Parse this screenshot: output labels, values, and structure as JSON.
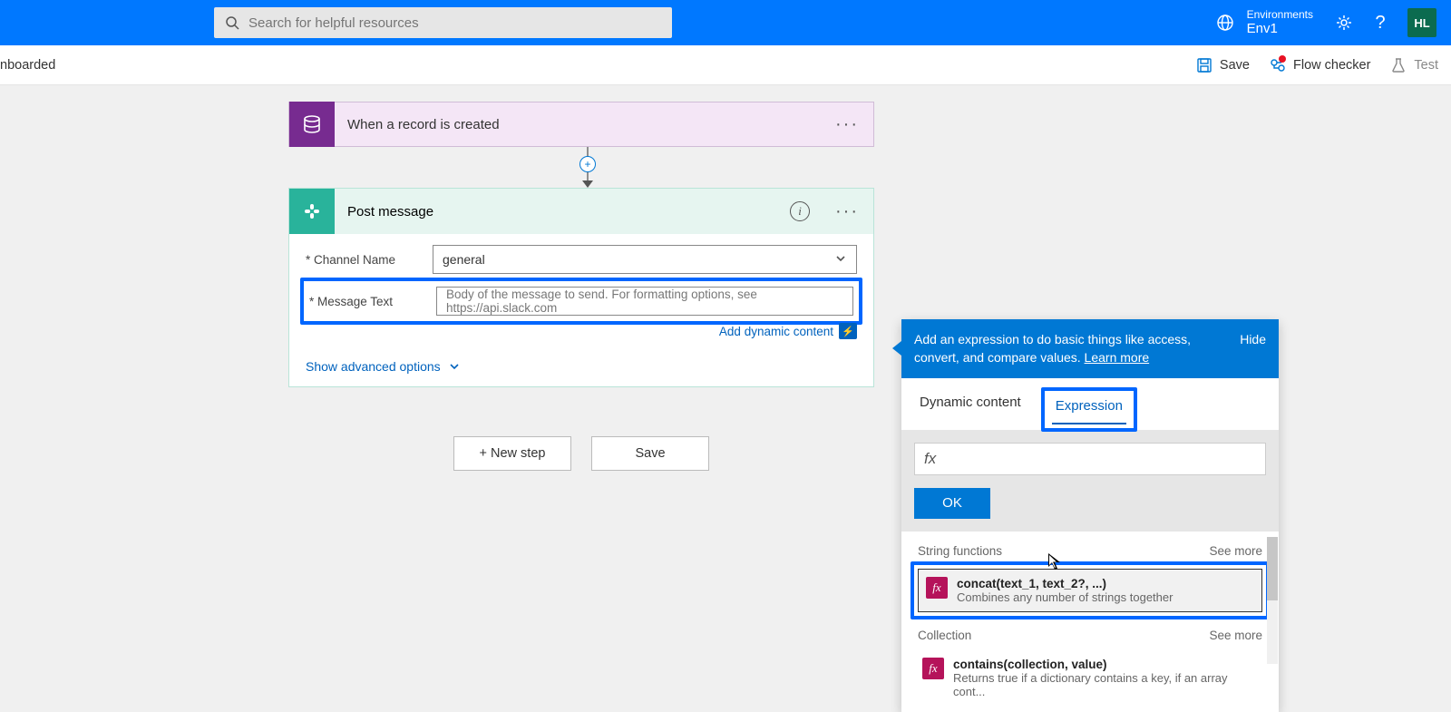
{
  "header": {
    "search_placeholder": "Search for helpful resources",
    "env_label": "Environments",
    "env_name": "Env1",
    "avatar": "HL"
  },
  "cmdbar": {
    "left_text": "nboarded",
    "save": "Save",
    "flow_checker": "Flow checker",
    "test": "Test"
  },
  "trigger": {
    "title": "When a record is created"
  },
  "action": {
    "title": "Post message",
    "channel_label": "* Channel Name",
    "channel_value": "general",
    "message_label": "* Message Text",
    "message_placeholder": "Body of the message to send. For formatting options, see https://api.slack.com",
    "add_dynamic": "Add dynamic content",
    "show_advanced": "Show advanced options"
  },
  "footer": {
    "new_step": "+ New step",
    "save": "Save"
  },
  "dc": {
    "help_text": "Add an expression to do basic things like access, convert, and compare values. ",
    "learn_more": "Learn more",
    "hide": "Hide",
    "tab_dynamic": "Dynamic content",
    "tab_expression": "Expression",
    "fx_symbol": "fx",
    "ok": "OK",
    "sections": [
      {
        "title": "String functions",
        "see_more": "See more",
        "items": [
          {
            "title": "concat(text_1, text_2?, ...)",
            "desc": "Combines any number of strings together"
          }
        ]
      },
      {
        "title": "Collection",
        "see_more": "See more",
        "items": [
          {
            "title": "contains(collection, value)",
            "desc": "Returns true if a dictionary contains a key, if an array cont..."
          }
        ]
      }
    ]
  }
}
